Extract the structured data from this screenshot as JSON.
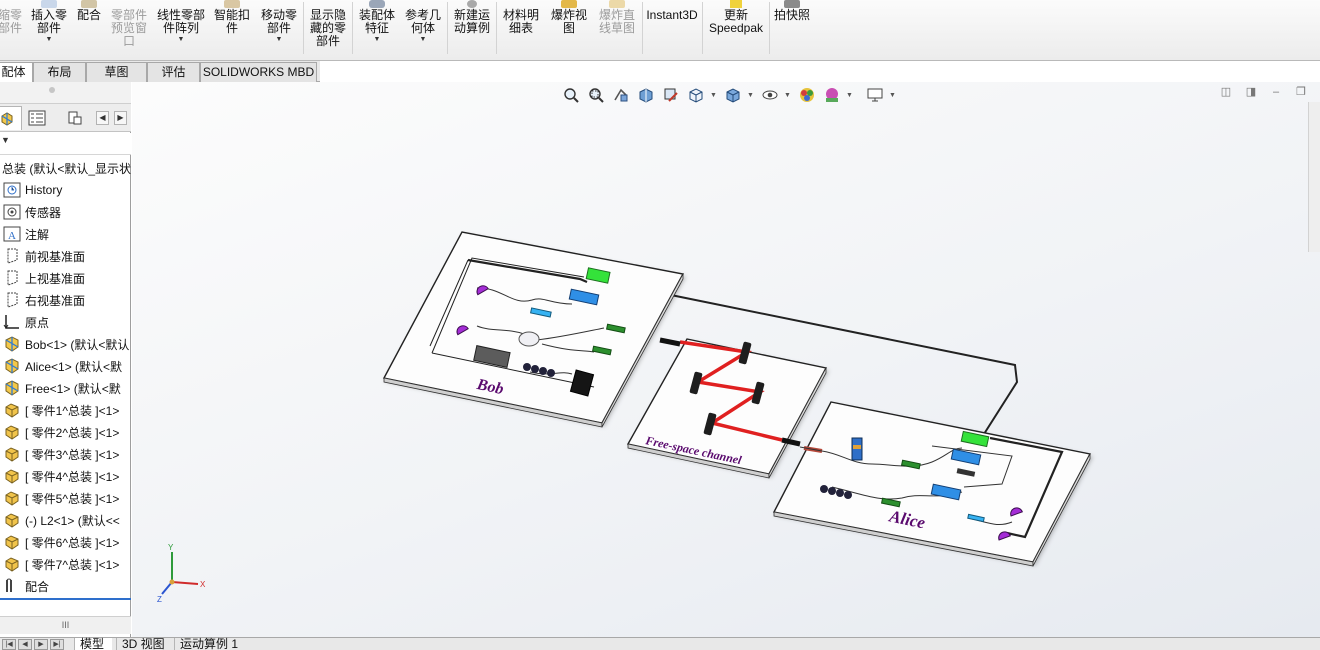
{
  "ribbon": {
    "items": [
      {
        "label": "缩零\n部件",
        "disabled": true
      },
      {
        "label": "插入零\n部件",
        "dropdown": true
      },
      {
        "label": "配合"
      },
      {
        "label": "零部件\n预览窗\n口",
        "disabled": true
      },
      {
        "label": "线性零部\n件阵列",
        "dropdown": true
      },
      {
        "label": "智能扣\n件"
      },
      {
        "label": "移动零\n部件",
        "dropdown": true
      },
      {
        "label": "显示隐\n藏的零\n部件"
      },
      {
        "label": "装配体\n特征",
        "dropdown": true
      },
      {
        "label": "参考几\n何体",
        "dropdown": true
      },
      {
        "label": "新建运\n动算例"
      },
      {
        "label": "材料明\n细表"
      },
      {
        "label": "爆炸视\n图"
      },
      {
        "label": "爆炸直\n线草图",
        "disabled": true
      },
      {
        "label": "Instant3D"
      },
      {
        "label": "更新\nSpeedpak"
      },
      {
        "label": "拍快照"
      }
    ]
  },
  "command_tabs": [
    "配体",
    "布局",
    "草图",
    "评估",
    "SOLIDWORKS MBD"
  ],
  "tree": {
    "root": "总装 (默认<默认_显示状",
    "items": [
      {
        "label": "History",
        "icon": "history-icon"
      },
      {
        "label": "传感器",
        "icon": "sensor-icon"
      },
      {
        "label": "注解",
        "icon": "annotation-icon"
      },
      {
        "label": "前视基准面",
        "icon": "plane-icon"
      },
      {
        "label": "上视基准面",
        "icon": "plane-icon"
      },
      {
        "label": "右视基准面",
        "icon": "plane-icon"
      },
      {
        "label": "原点",
        "icon": "origin-icon"
      },
      {
        "label": "Bob<1> (默认<默认",
        "icon": "assembly-icon"
      },
      {
        "label": "Alice<1> (默认<默",
        "icon": "assembly-icon"
      },
      {
        "label": "Free<1> (默认<默",
        "icon": "assembly-icon"
      },
      {
        "label": "[ 零件1^总装 ]<1>",
        "icon": "part-icon"
      },
      {
        "label": "[ 零件2^总装 ]<1>",
        "icon": "part-icon"
      },
      {
        "label": "[ 零件3^总装 ]<1>",
        "icon": "part-icon"
      },
      {
        "label": "[ 零件4^总装 ]<1>",
        "icon": "part-icon"
      },
      {
        "label": "[ 零件5^总装 ]<1>",
        "icon": "part-icon"
      },
      {
        "label": "(-) L2<1> (默认<<",
        "icon": "part-icon"
      },
      {
        "label": "[ 零件6^总装 ]<1>",
        "icon": "part-icon"
      },
      {
        "label": "[ 零件7^总装 ]<1>",
        "icon": "part-icon"
      },
      {
        "label": "配合",
        "icon": "mates-icon"
      }
    ],
    "scroll_label": "III"
  },
  "scene": {
    "bob_label": "Bob",
    "alice_label": "Alice",
    "channel_label": "Free-space channel",
    "triad": {
      "y": "Y",
      "x": "X",
      "z": "Z"
    }
  },
  "bottom_tabs": [
    "模型",
    "3D 视图",
    "运动算例 1"
  ],
  "colors": {
    "accent": "#2e6fcc",
    "laser": "#e02020",
    "fiber": "#222222",
    "label_purple": "#5a0a6e"
  }
}
